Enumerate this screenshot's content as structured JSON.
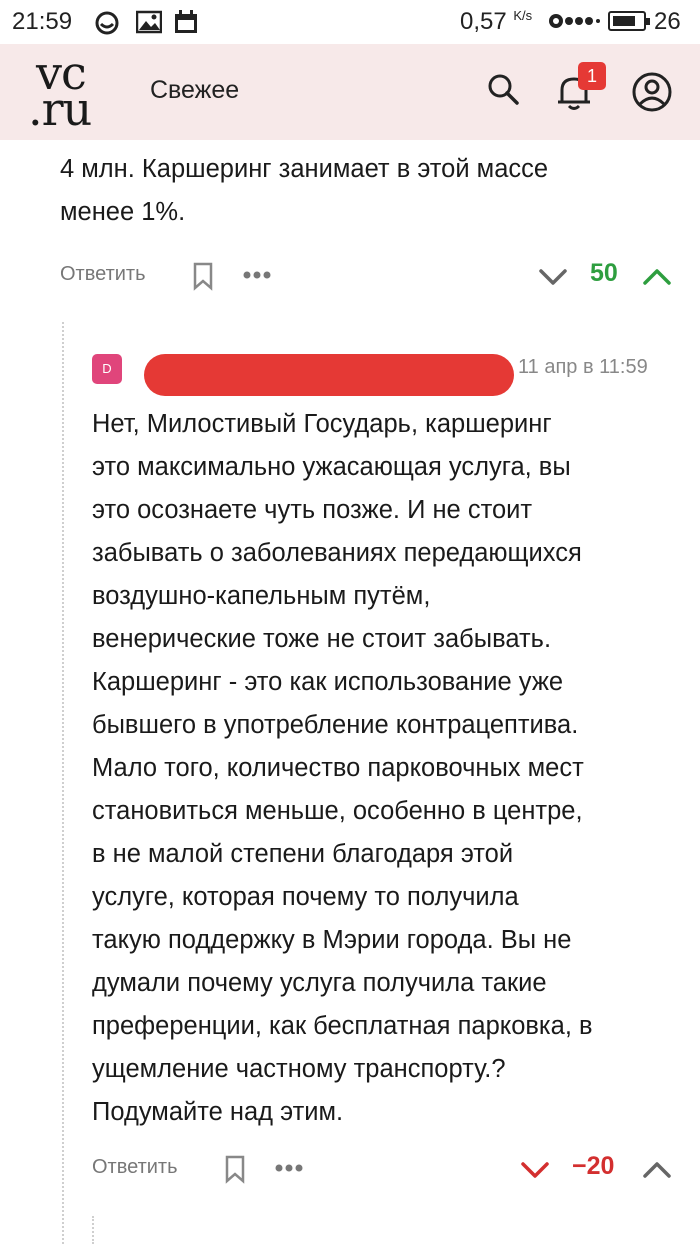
{
  "status_bar": {
    "time": "21:59",
    "speed": "0,57",
    "speed_unit": "K/s",
    "battery": "26"
  },
  "header": {
    "logo_line1": "vc",
    "logo_line2": ".ru",
    "section": "Свежее",
    "notification_count": "1"
  },
  "previous_comment": {
    "text_line1": "4 млн. Каршеринг занимает в этой массе",
    "text_line2": "менее 1%.",
    "reply_label": "Ответить",
    "score": "50",
    "score_color": "#2e9e3f"
  },
  "comment": {
    "avatar_letter": "D",
    "date": "11 апр в 11:59",
    "lines": [
      "Нет, Милостивый Государь, каршеринг",
      "это максимально ужасающая услуга, вы",
      "это осознаете чуть позже. И не стоит",
      "забывать о заболеваниях передающихся",
      "воздушно-капельным путём,",
      "венерические тоже не стоит забывать.",
      "Каршеринг - это как использование уже",
      "бывшего в употребление контрацептива.",
      "Мало того, количество парковочных мест",
      "становиться меньше, особенно в центре,",
      "в не малой степени благодаря этой",
      "услуге, которая почему то получила",
      "такую поддержку в Мэрии города. Вы не",
      "думали почему услуга получила такие",
      "преференции, как бесплатная парковка, в",
      "ущемление частному транспорту.?",
      "Подумайте над этим."
    ],
    "reply_label": "Ответить",
    "score": "−20",
    "score_color": "#d32f2f"
  }
}
